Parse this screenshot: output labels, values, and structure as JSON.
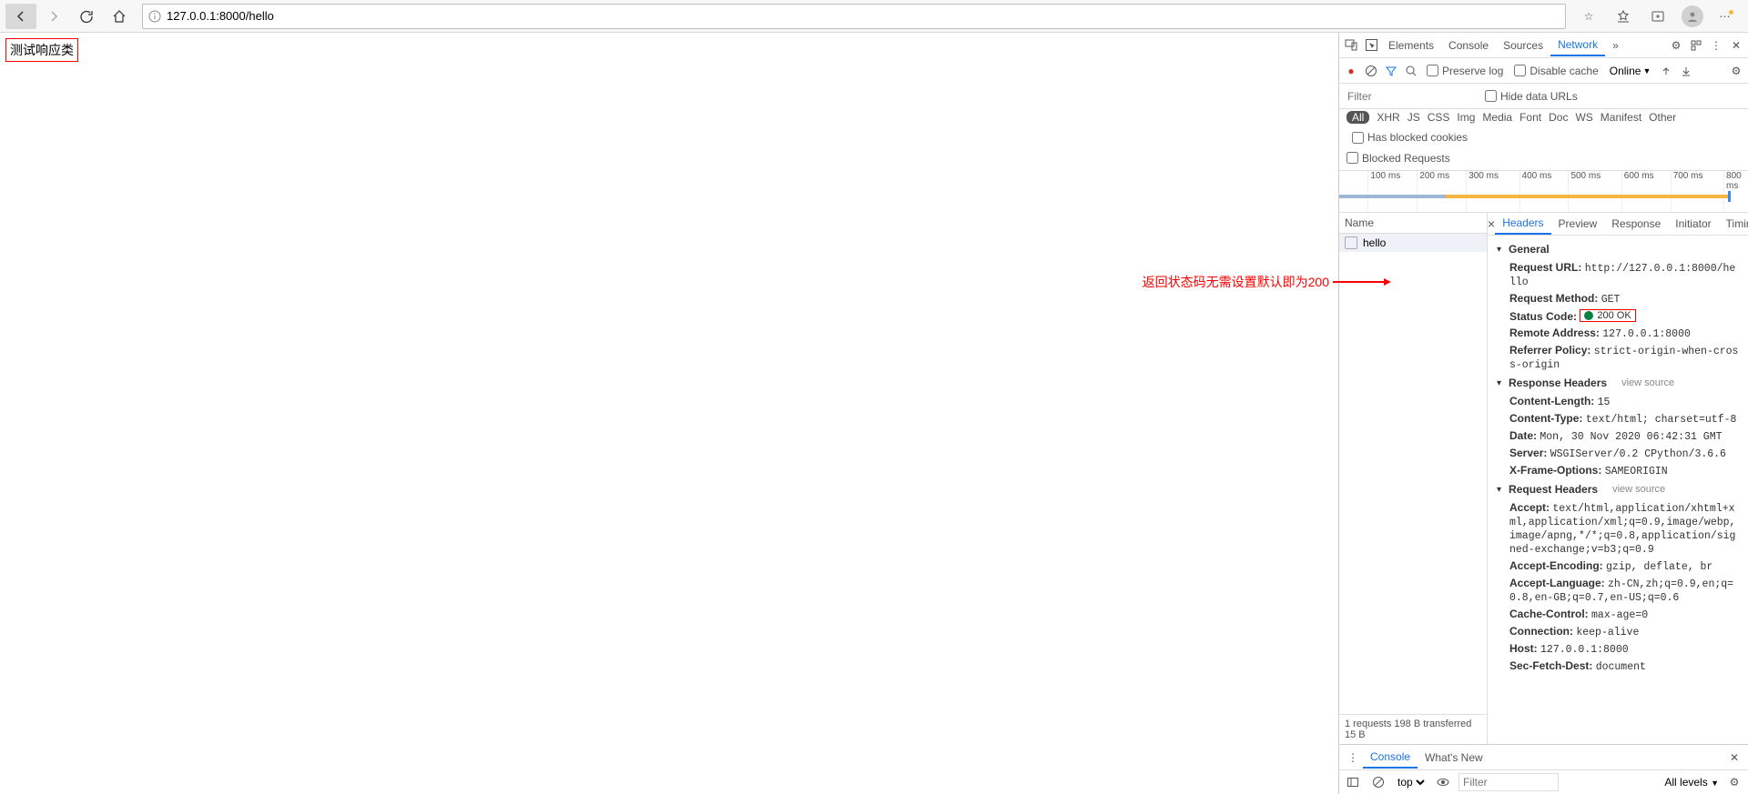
{
  "nav": {
    "url": "127.0.0.1:8000/hello"
  },
  "page": {
    "body_text": "测试响应类",
    "annotation_text": "返回状态码无需设置默认即为200"
  },
  "devtools": {
    "top_tabs": [
      "Elements",
      "Console",
      "Sources",
      "Network"
    ],
    "top_active": "Network",
    "toolbar": {
      "preserve_log": "Preserve log",
      "disable_cache": "Disable cache",
      "online": "Online"
    },
    "filter": {
      "placeholder": "Filter",
      "hide_data_urls": "Hide data URLs",
      "blocked_cookies": "Has blocked cookies",
      "types": [
        "All",
        "XHR",
        "JS",
        "CSS",
        "Img",
        "Media",
        "Font",
        "Doc",
        "WS",
        "Manifest",
        "Other"
      ],
      "type_active": "All",
      "blocked_requests": "Blocked Requests"
    },
    "waterfall_ticks": [
      "100 ms",
      "200 ms",
      "300 ms",
      "400 ms",
      "500 ms",
      "600 ms",
      "700 ms",
      "800 ms"
    ],
    "list": {
      "name_header": "Name",
      "row": "hello",
      "status": "1 requests   198 B transferred   15 B"
    },
    "detail_tabs": [
      "Headers",
      "Preview",
      "Response",
      "Initiator",
      "Timing"
    ],
    "detail_active": "Headers",
    "sections": {
      "general": {
        "title": "General",
        "request_url_k": "Request URL:",
        "request_url_v": "http://127.0.0.1:8000/hello",
        "request_method_k": "Request Method:",
        "request_method_v": "GET",
        "status_code_k": "Status Code:",
        "status_code_v": "200 OK",
        "remote_addr_k": "Remote Address:",
        "remote_addr_v": "127.0.0.1:8000",
        "referrer_policy_k": "Referrer Policy:",
        "referrer_policy_v": "strict-origin-when-cross-origin"
      },
      "response": {
        "title": "Response Headers",
        "view_source": "view source",
        "content_length_k": "Content-Length:",
        "content_length_v": "15",
        "content_type_k": "Content-Type:",
        "content_type_v": "text/html; charset=utf-8",
        "date_k": "Date:",
        "date_v": "Mon, 30 Nov 2020 06:42:31 GMT",
        "server_k": "Server:",
        "server_v": "WSGIServer/0.2 CPython/3.6.6",
        "xfo_k": "X-Frame-Options:",
        "xfo_v": "SAMEORIGIN"
      },
      "request": {
        "title": "Request Headers",
        "view_source": "view source",
        "accept_k": "Accept:",
        "accept_v": "text/html,application/xhtml+xml,application/xml;q=0.9,image/webp,image/apng,*/*;q=0.8,application/signed-exchange;v=b3;q=0.9",
        "accept_encoding_k": "Accept-Encoding:",
        "accept_encoding_v": "gzip, deflate, br",
        "accept_language_k": "Accept-Language:",
        "accept_language_v": "zh-CN,zh;q=0.9,en;q=0.8,en-GB;q=0.7,en-US;q=0.6",
        "cache_control_k": "Cache-Control:",
        "cache_control_v": "max-age=0",
        "connection_k": "Connection:",
        "connection_v": "keep-alive",
        "host_k": "Host:",
        "host_v": "127.0.0.1:8000",
        "sec_fetch_dest_k": "Sec-Fetch-Dest:",
        "sec_fetch_dest_v": "document"
      }
    },
    "drawer": {
      "tabs": [
        "Console",
        "What's New"
      ],
      "active": "Console",
      "context": "top",
      "filter_placeholder": "Filter",
      "levels": "All levels"
    }
  }
}
